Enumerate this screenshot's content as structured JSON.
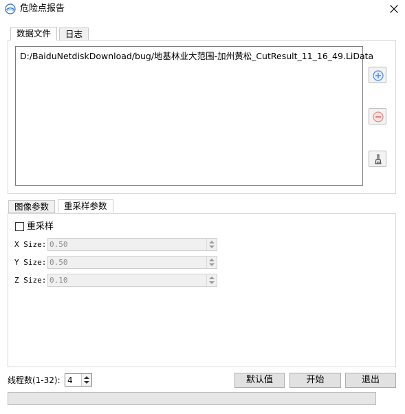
{
  "window": {
    "title": "危险点报告",
    "close_icon": "close-icon"
  },
  "top_tabs": [
    {
      "label": "数据文件",
      "active": true
    },
    {
      "label": "日志",
      "active": false
    }
  ],
  "file_list": {
    "items": [
      "D:/BaiduNetdiskDownload/bug/地基林业大范围-加州黄松_CutResult_11_16_49.LiData"
    ]
  },
  "side_buttons": {
    "add_icon": "plus-circle-icon",
    "remove_icon": "minus-circle-icon",
    "clear_icon": "brush-icon"
  },
  "bottom_tabs": [
    {
      "label": "图像参数",
      "active": false
    },
    {
      "label": "重采样参数",
      "active": true
    }
  ],
  "resample": {
    "label": "重采样",
    "checked": false,
    "x": {
      "label": "X Size:",
      "value": "0.50"
    },
    "y": {
      "label": "Y Size:",
      "value": "0.50"
    },
    "z": {
      "label": "Z Size:",
      "value": "0.10"
    }
  },
  "threads": {
    "label": "线程数(1-32):",
    "value": "4"
  },
  "buttons": {
    "default_label": "默认值",
    "start_label": "开始",
    "exit_label": "退出"
  },
  "progress": {
    "value": 0
  },
  "colors": {
    "accent": "#4a86e8",
    "remove": "#e05050",
    "progress": "#06b025"
  }
}
